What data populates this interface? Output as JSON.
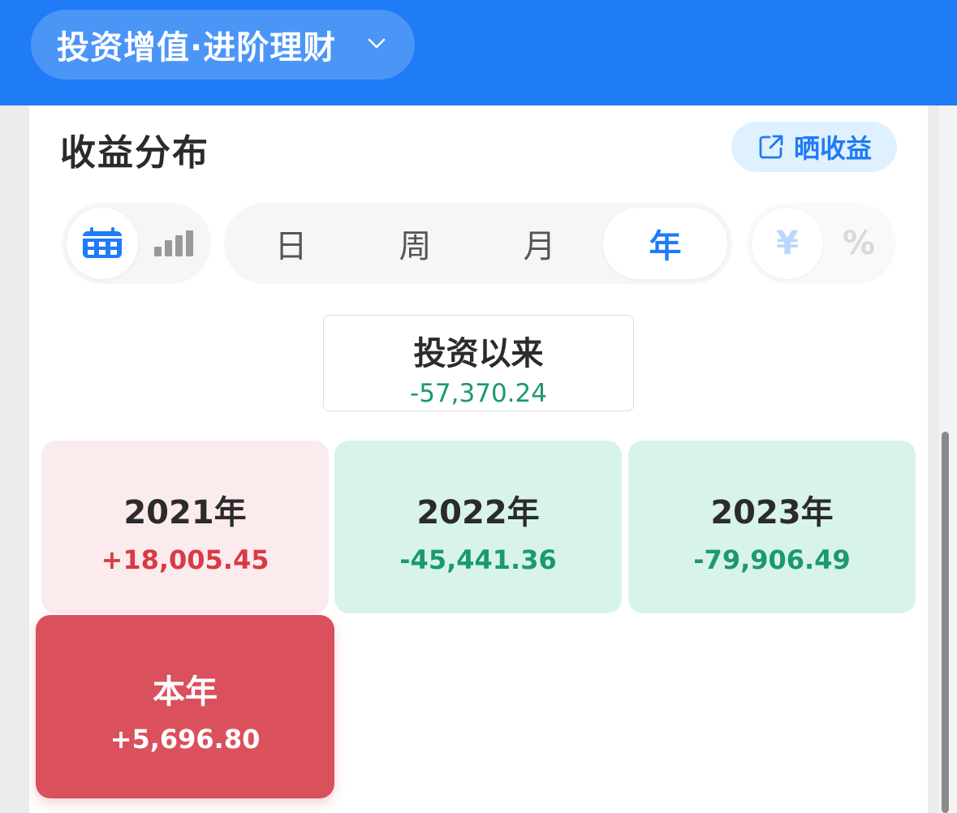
{
  "header": {
    "account_label": "投资增值·进阶理财",
    "dropdown_icon": "chevron-down-icon"
  },
  "section": {
    "title": "收益分布",
    "share_label": "晒收益",
    "share_icon": "external-share-icon"
  },
  "view_toggle": {
    "options": [
      {
        "icon": "calendar-icon",
        "active": true
      },
      {
        "icon": "bar-chart-icon",
        "active": false
      }
    ]
  },
  "period_tabs": {
    "items": [
      "日",
      "周",
      "月",
      "年"
    ],
    "active_index": 3
  },
  "unit_toggle": {
    "items": [
      "¥",
      "%"
    ],
    "active_index": 0
  },
  "total": {
    "label": "投资以来",
    "value": "-57,370.24"
  },
  "years": [
    {
      "label": "2021年",
      "value": "+18,005.45",
      "trend": "up"
    },
    {
      "label": "2022年",
      "value": "-45,441.36",
      "trend": "down"
    },
    {
      "label": "2023年",
      "value": "-79,906.49",
      "trend": "down"
    }
  ],
  "current_year": {
    "label": "本年",
    "value": "+5,696.80"
  },
  "colors": {
    "brand": "#1f7bf6",
    "gain": "#d93a46",
    "loss": "#1a9a6c",
    "gain_bg": "#fcebec",
    "loss_bg": "#d8f3ec",
    "current_bg": "#da505c"
  }
}
